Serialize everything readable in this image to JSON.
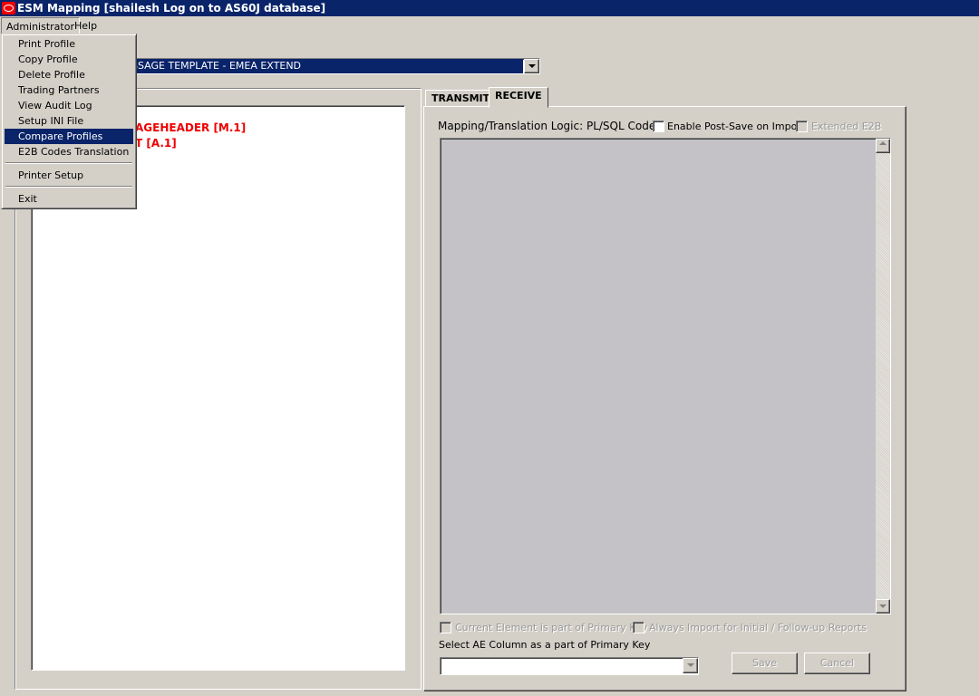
{
  "window": {
    "title": "ESM Mapping [shailesh Log on to AS60J database]"
  },
  "menubar": [
    {
      "label": "Administrator"
    },
    {
      "label": "Help"
    }
  ],
  "admin_menu": {
    "items": [
      "Print Profile",
      "Copy Profile",
      "Delete Profile",
      "Trading Partners",
      "View Audit Log",
      "Setup INI File",
      "Compare Profiles",
      "E2B Codes Translation"
    ],
    "items2": [
      "Printer Setup"
    ],
    "items3": [
      "Exit"
    ],
    "highlighted": "Compare Profiles"
  },
  "profile_combo": {
    "value": "SSAGE TEMPLATE - EMEA EXTEND"
  },
  "tree": {
    "items": [
      "AGEHEADER [M.1]",
      "T [A.1]"
    ],
    "color": "#e00000"
  },
  "tabs": [
    {
      "label": "TRANSMIT"
    },
    {
      "label": "RECEIVE",
      "active": true
    }
  ],
  "receive": {
    "logic_label": "Mapping/Translation Logic: PL/SQL Code",
    "enable_post_save": {
      "label": "Enable Post-Save on Import",
      "checked": false
    },
    "extended_e2b": {
      "label": "Extended E2B",
      "checked": false,
      "disabled": true
    },
    "code": "",
    "primary_key": {
      "label": "Current Element is part of Primary Key",
      "checked": false,
      "disabled": true
    },
    "always_import": {
      "label": "Always Import for Initial / Follow-up Reports",
      "checked": false,
      "disabled": true
    },
    "ae_column_label": "Select AE Column as a part of Primary Key",
    "ae_column_value": "",
    "save": "Save",
    "cancel": "Cancel"
  },
  "colors": {
    "titlebar": "#0a246a",
    "face": "#d4d0c8",
    "editor": "#c4c2c6"
  }
}
